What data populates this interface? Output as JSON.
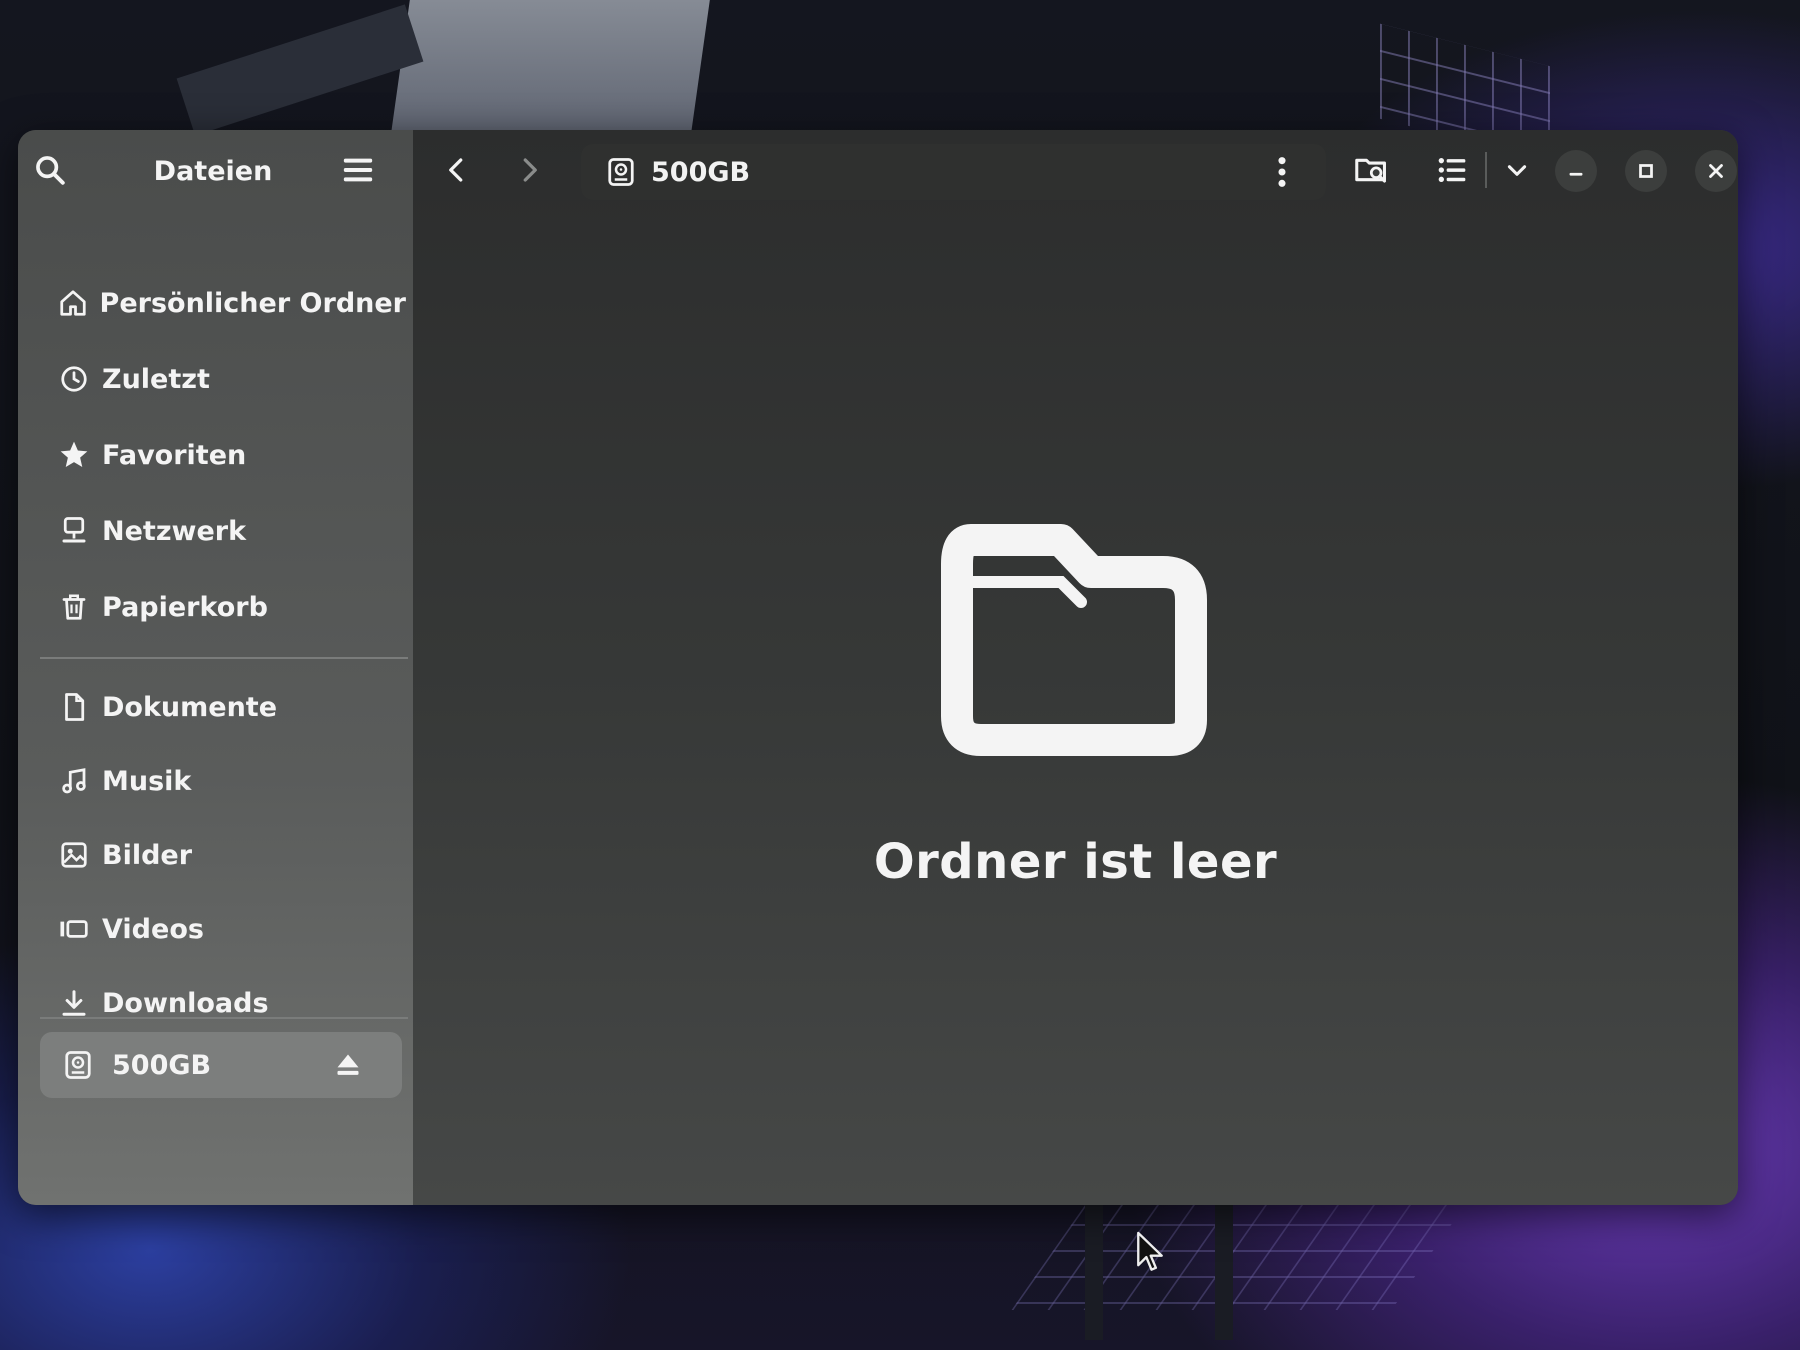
{
  "sidebar": {
    "title": "Dateien",
    "places": [
      {
        "label": "Persönlicher Ordner",
        "icon": "home-icon"
      },
      {
        "label": "Zuletzt",
        "icon": "clock-icon"
      },
      {
        "label": "Favoriten",
        "icon": "star-icon"
      },
      {
        "label": "Netzwerk",
        "icon": "network-icon"
      },
      {
        "label": "Papierkorb",
        "icon": "trash-icon"
      }
    ],
    "bookmarks": [
      {
        "label": "Dokumente",
        "icon": "document-icon"
      },
      {
        "label": "Musik",
        "icon": "music-icon"
      },
      {
        "label": "Bilder",
        "icon": "image-icon"
      },
      {
        "label": "Videos",
        "icon": "video-icon"
      },
      {
        "label": "Downloads",
        "icon": "download-icon"
      }
    ],
    "drive": {
      "label": "500GB",
      "icon": "drive-icon",
      "selected": true
    }
  },
  "toolbar": {
    "location": "500GB"
  },
  "main": {
    "empty_message": "Ordner ist leer"
  },
  "colors": {
    "sidebar_bg": "#4a4c4b",
    "main_bg": "#2c2d2d",
    "text": "#f4f4f4",
    "selected_bg": "#7c7e7d"
  }
}
